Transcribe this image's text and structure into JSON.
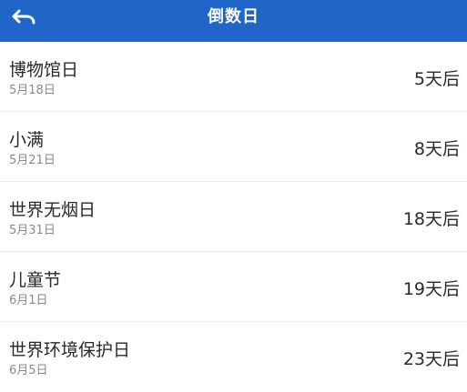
{
  "header": {
    "title": "倒数日",
    "back_icon": "undo-arrow-icon",
    "background_color": "#1f66c8",
    "text_color": "#ffffff"
  },
  "events": [
    {
      "name": "博物馆日",
      "date": "5月18日",
      "days_left": "5天后"
    },
    {
      "name": "小满",
      "date": "5月21日",
      "days_left": "8天后"
    },
    {
      "name": "世界无烟日",
      "date": "5月31日",
      "days_left": "18天后"
    },
    {
      "name": "儿童节",
      "date": "6月1日",
      "days_left": "19天后"
    },
    {
      "name": "世界环境保护日",
      "date": "6月5日",
      "days_left": "23天后"
    }
  ]
}
